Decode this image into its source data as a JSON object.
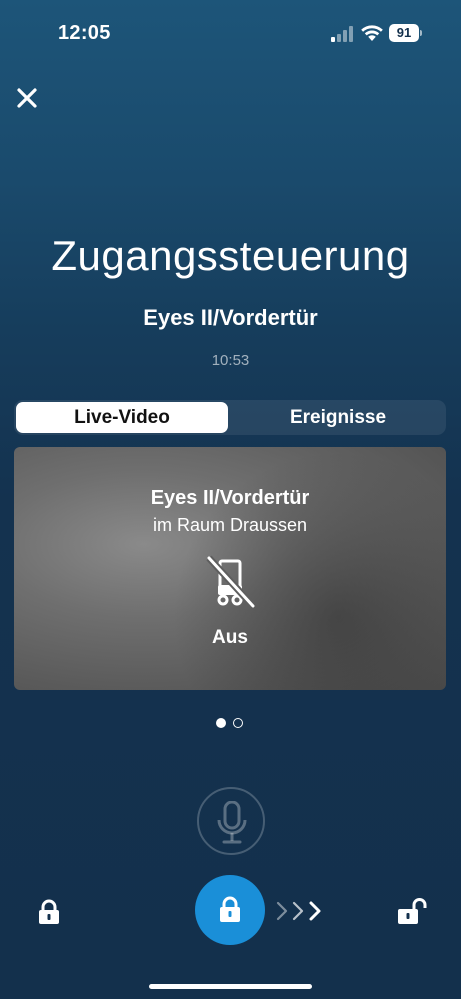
{
  "status_bar": {
    "time": "12:05",
    "battery": "91",
    "icons": [
      "signal-icon",
      "wifi-icon",
      "battery-icon"
    ]
  },
  "header": {
    "close_icon": "close-icon"
  },
  "main": {
    "title": "Zugangssteuerung",
    "device_name": "Eyes II/Vordertür",
    "time": "10:53"
  },
  "tabs": [
    {
      "label": "Live-Video",
      "active": true
    },
    {
      "label": "Ereignisse",
      "active": false
    }
  ],
  "camera_card": {
    "device_name": "Eyes II/Vordertür",
    "room": "im Raum Draussen",
    "status_icon": "camera-off-icon",
    "status": "Aus"
  },
  "pagination": {
    "current_page": 1,
    "total_pages": 2
  },
  "controls": {
    "mic_icon": "microphone-icon",
    "lock_icon": "lock-icon",
    "main_lock_icon": "lock-icon",
    "swipe_icon": "chevrons-right-icon",
    "unlock_icon": "unlock-icon",
    "accent_color": "#1a8fd8"
  }
}
